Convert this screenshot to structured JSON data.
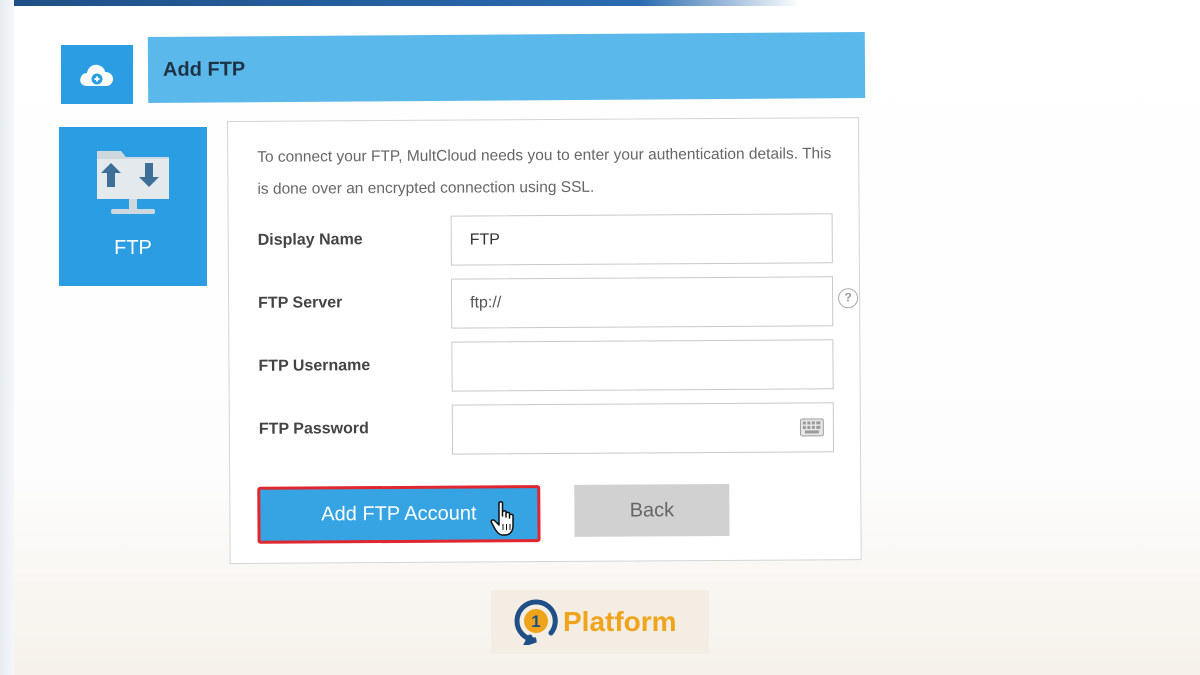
{
  "header": {
    "icon": "cloud-add-icon",
    "title": "Add FTP"
  },
  "service_tile": {
    "icon": "ftp-folder-transfer-icon",
    "label": "FTP"
  },
  "form": {
    "intro": "To connect your FTP, MultCloud needs you to enter your authentication details. This is done over an encrypted connection using SSL.",
    "fields": [
      {
        "label": "Display Name",
        "value": "FTP",
        "placeholder": ""
      },
      {
        "label": "FTP Server",
        "value": "",
        "placeholder": "ftp://"
      },
      {
        "label": "FTP Username",
        "value": "",
        "placeholder": ""
      },
      {
        "label": "FTP Password",
        "value": "",
        "placeholder": ""
      }
    ],
    "help_icon": "help-icon",
    "keyboard_icon": "keyboard-icon"
  },
  "actions": {
    "primary_label": "Add FTP Account",
    "secondary_label": "Back"
  },
  "watermark": {
    "text": "Platform",
    "logo_text": "1"
  },
  "colors": {
    "accent_blue": "#2a9de3",
    "header_bar": "#5bb8ea",
    "highlight_border": "#e0262e",
    "watermark_orange": "#f0a41c"
  }
}
